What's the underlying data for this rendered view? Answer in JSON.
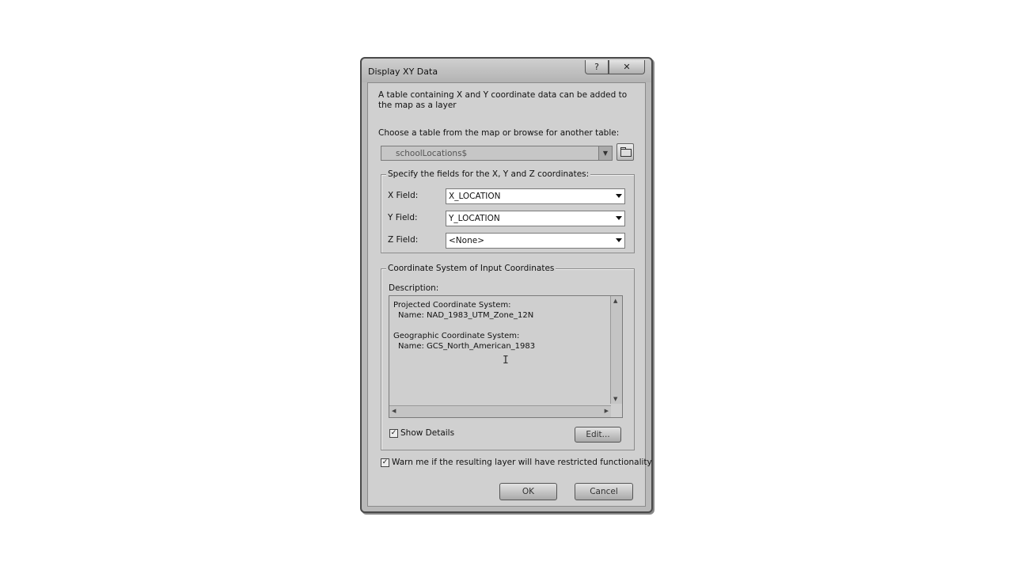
{
  "window": {
    "title": "Display XY Data",
    "help_label": "?",
    "close_label": "✕"
  },
  "intro_text": "A table containing X and Y coordinate data can be added to the map as a layer",
  "table_chooser": {
    "label": "Choose a table from the map or browse for another table:",
    "value": "schoolLocations$",
    "browse_icon": "folder-icon"
  },
  "fields_group": {
    "legend": "Specify the fields for the X, Y and Z coordinates:",
    "x_label": "X Field:",
    "x_value": "X_LOCATION",
    "y_label": "Y Field:",
    "y_value": "Y_LOCATION",
    "z_label": "Z Field:",
    "z_value": "<None>"
  },
  "coord_group": {
    "legend": "Coordinate System of Input Coordinates",
    "description_label": "Description:",
    "lines": [
      "Projected Coordinate System:",
      "Name: NAD_1983_UTM_Zone_12N",
      "Geographic Coordinate System:",
      "Name: GCS_North_American_1983"
    ],
    "show_details_label": "Show Details",
    "show_details_checked": true,
    "edit_label": "Edit..."
  },
  "warn_label": "Warn me if the resulting layer will have restricted functionality",
  "warn_checked": true,
  "ok_label": "OK",
  "cancel_label": "Cancel"
}
